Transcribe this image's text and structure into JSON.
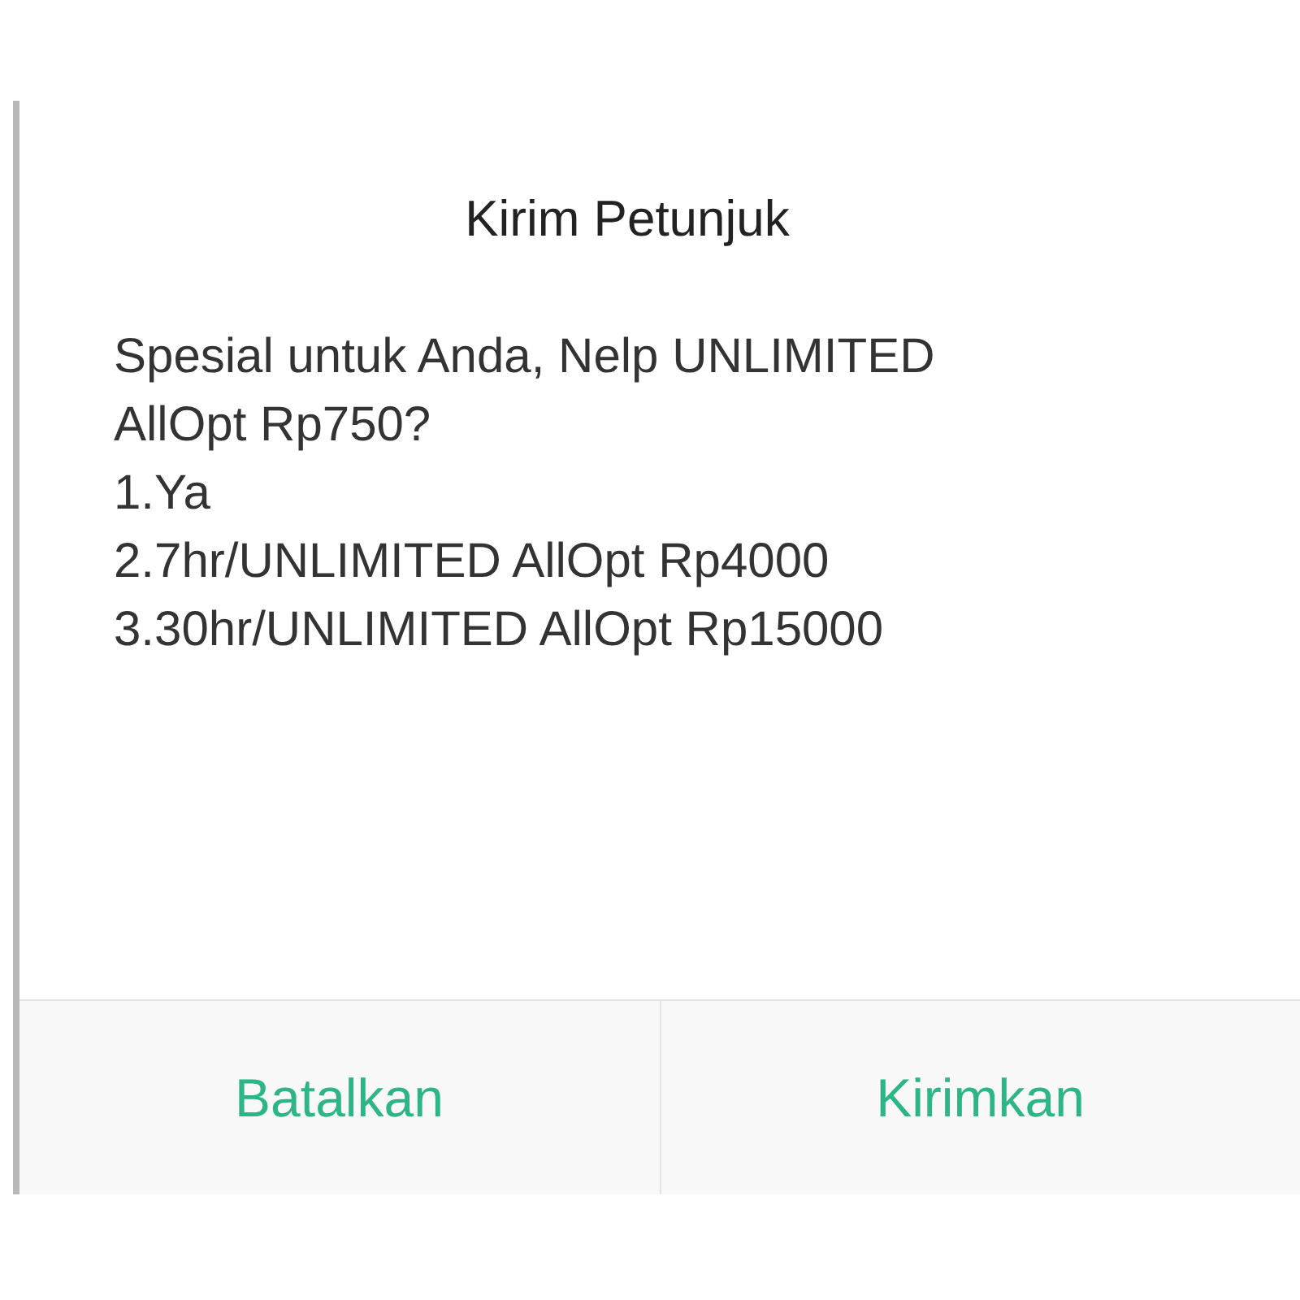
{
  "dialog": {
    "title": "Kirim Petunjuk",
    "message_lines": [
      "Spesial untuk Anda, Nelp UNLIMITED",
      "AllOpt Rp750?",
      "1.Ya",
      "2.7hr/UNLIMITED AllOpt Rp4000",
      "3.30hr/UNLIMITED AllOpt Rp15000"
    ],
    "buttons": [
      {
        "label": "Batalkan"
      },
      {
        "label": "Kirimkan"
      }
    ]
  }
}
